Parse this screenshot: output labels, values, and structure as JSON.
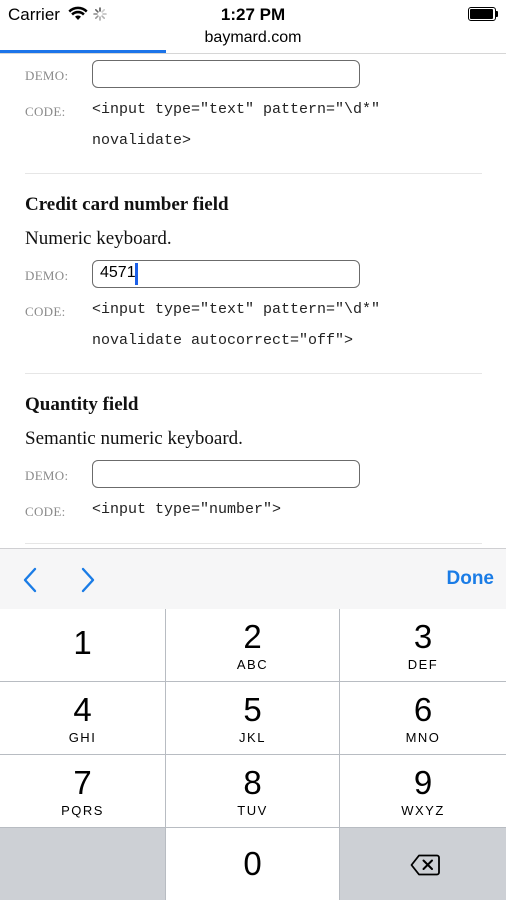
{
  "status_bar": {
    "carrier": "Carrier",
    "time": "1:27 PM"
  },
  "browser": {
    "url": "baymard.com",
    "load_progress_percent": 33
  },
  "sections": {
    "top": {
      "demo_label": "DEMO:",
      "code_label": "CODE:",
      "demo_value": "",
      "code_line1": "<input type=\"text\" pattern=\"\\d*\"",
      "code_line2": "novalidate>"
    },
    "credit_card": {
      "title": "Credit card number field",
      "description": "Numeric keyboard.",
      "demo_label": "DEMO:",
      "code_label": "CODE:",
      "demo_value": "4571",
      "code_line1": "<input type=\"text\" pattern=\"\\d*\"",
      "code_line2": "novalidate autocorrect=\"off\">"
    },
    "quantity": {
      "title": "Quantity field",
      "description": "Semantic numeric keyboard.",
      "demo_label": "DEMO:",
      "code_label": "CODE:",
      "demo_value": "",
      "code_line1": "<input type=\"number\">"
    }
  },
  "accessory_bar": {
    "prev_icon": "chevron-left-icon",
    "next_icon": "chevron-right-icon",
    "done_label": "Done",
    "accent_color": "#1a7ce6"
  },
  "keypad": {
    "keys": [
      {
        "digit": "1",
        "letters": ""
      },
      {
        "digit": "2",
        "letters": "ABC"
      },
      {
        "digit": "3",
        "letters": "DEF"
      },
      {
        "digit": "4",
        "letters": "GHI"
      },
      {
        "digit": "5",
        "letters": "JKL"
      },
      {
        "digit": "6",
        "letters": "MNO"
      },
      {
        "digit": "7",
        "letters": "PQRS"
      },
      {
        "digit": "8",
        "letters": "TUV"
      },
      {
        "digit": "9",
        "letters": "WXYZ"
      },
      {
        "digit": "0",
        "letters": ""
      }
    ],
    "backspace_icon": "backspace-icon"
  }
}
